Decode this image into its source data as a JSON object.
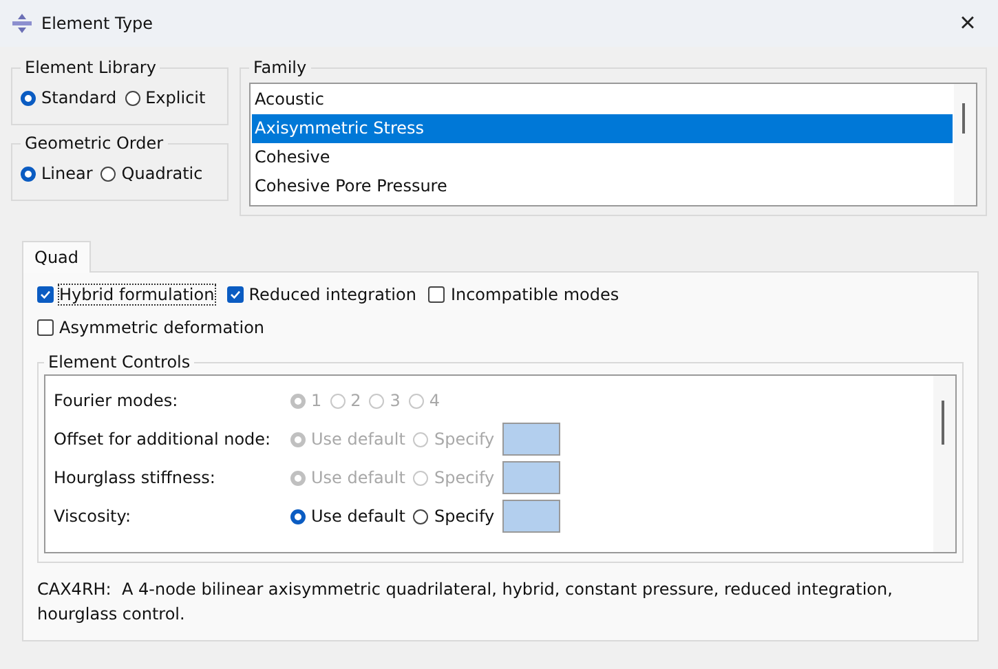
{
  "window": {
    "title": "Element Type",
    "close": "×"
  },
  "element_library": {
    "title": "Element Library",
    "options": [
      {
        "label": "Standard",
        "selected": true
      },
      {
        "label": "Explicit",
        "selected": false
      }
    ]
  },
  "geometric_order": {
    "title": "Geometric Order",
    "options": [
      {
        "label": "Linear",
        "selected": true
      },
      {
        "label": "Quadratic",
        "selected": false
      }
    ]
  },
  "family": {
    "title": "Family",
    "items": [
      {
        "label": "Acoustic",
        "selected": false
      },
      {
        "label": "Axisymmetric Stress",
        "selected": true
      },
      {
        "label": "Cohesive",
        "selected": false
      },
      {
        "label": "Cohesive Pore Pressure",
        "selected": false
      }
    ]
  },
  "tabs": [
    {
      "label": "Quad",
      "selected": true
    }
  ],
  "options": [
    {
      "label": "Hybrid formulation",
      "checked": true,
      "focused": true
    },
    {
      "label": "Reduced integration",
      "checked": true,
      "focused": false
    },
    {
      "label": "Incompatible modes",
      "checked": false,
      "focused": false
    },
    {
      "label": "Asymmetric deformation",
      "checked": false,
      "focused": false
    }
  ],
  "element_controls": {
    "title": "Element Controls",
    "rows": [
      {
        "label": "Fourier modes:",
        "disabled": true,
        "field": false,
        "options": [
          {
            "label": "1",
            "selected": true
          },
          {
            "label": "2",
            "selected": false
          },
          {
            "label": "3",
            "selected": false
          },
          {
            "label": "4",
            "selected": false
          }
        ]
      },
      {
        "label": "Offset for additional node:",
        "disabled": true,
        "field": true,
        "options": [
          {
            "label": "Use default",
            "selected": true
          },
          {
            "label": "Specify",
            "selected": false
          }
        ]
      },
      {
        "label": "Hourglass stiffness:",
        "disabled": true,
        "field": true,
        "options": [
          {
            "label": "Use default",
            "selected": true
          },
          {
            "label": "Specify",
            "selected": false
          }
        ]
      },
      {
        "label": "Viscosity:",
        "disabled": false,
        "field": true,
        "options": [
          {
            "label": "Use default",
            "selected": true
          },
          {
            "label": "Specify",
            "selected": false
          }
        ]
      }
    ]
  },
  "description": "CAX4RH:  A 4-node bilinear axisymmetric quadrilateral, hybrid, constant pressure, reduced integration, hourglass control."
}
